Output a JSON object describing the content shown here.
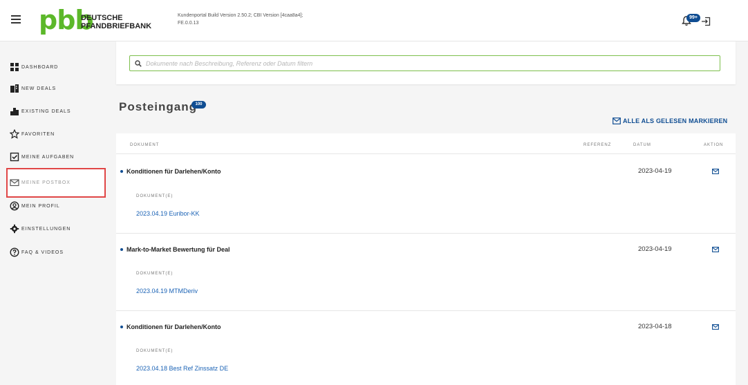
{
  "header": {
    "logo": "pbb",
    "brand_line1": "DEUTSCHE",
    "brand_line2": "PFANDBRIEFBANK",
    "build_line1": "Kundenportal Build Version 2.50.2; CBI Version [4caa8a4];",
    "build_line2": "FE.0.0.13",
    "notification_badge": "99+"
  },
  "sidebar": {
    "items": [
      {
        "label": "DASHBOARD",
        "icon": "dashboard-grid-icon"
      },
      {
        "label": "NEW DEALS",
        "icon": "new-deals-icon"
      },
      {
        "label": "EXISTING DEALS",
        "icon": "buildings-icon"
      },
      {
        "label": "FAVORITEN",
        "icon": "star-icon"
      },
      {
        "label": "MEINE AUFGABEN",
        "icon": "checkbox-icon"
      },
      {
        "label": "MEINE POSTBOX",
        "icon": "mail-icon"
      },
      {
        "label": "MEIN PROFIL",
        "icon": "user-circle-icon"
      },
      {
        "label": "EINSTELLUNGEN",
        "icon": "gear-icon"
      },
      {
        "label": "FAQ & VIDEOS",
        "icon": "help-icon"
      }
    ],
    "active": "MEINE POSTBOX"
  },
  "search": {
    "placeholder": "Dokumente nach Beschreibung, Referenz oder Datum filtern"
  },
  "inbox": {
    "title": "Posteingang",
    "count_badge": "100",
    "mark_all_label": "ALLE ALS GELESEN MARKIEREN",
    "columns": {
      "document": "DOKUMENT",
      "reference": "REFERENZ",
      "date": "DATUM",
      "action": "AKTION"
    },
    "rows": [
      {
        "title": "Konditionen für Darlehen/Konto",
        "doc_label": "DOKUMENT(E)",
        "doc_link": "2023.04.19 Euribor-KK",
        "date": "2023-04-19"
      },
      {
        "title": "Mark-to-Market Bewertung für Deal",
        "doc_label": "DOKUMENT(E)",
        "doc_link": "2023.04.19 MTMDeriv",
        "date": "2023-04-19"
      },
      {
        "title": "Konditionen für Darlehen/Konto",
        "doc_label": "DOKUMENT(E)",
        "doc_link": "2023.04.18 Best Ref Zinssatz DE",
        "date": "2023-04-18"
      }
    ]
  },
  "colors": {
    "brand_green": "#5cb82a",
    "accent_blue": "#0f4d92",
    "link_blue": "#1a62b5",
    "highlight_red": "#e04545"
  }
}
